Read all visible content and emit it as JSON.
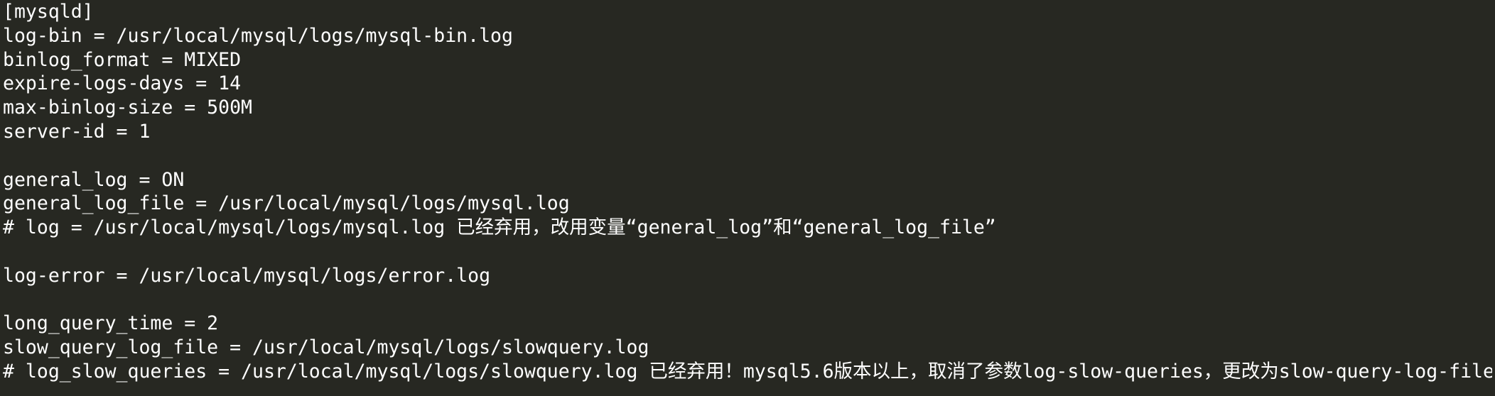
{
  "editor": {
    "lines": [
      "[mysqld]",
      "log-bin = /usr/local/mysql/logs/mysql-bin.log",
      "binlog_format = MIXED",
      "expire-logs-days = 14",
      "max-binlog-size = 500M",
      "server-id = 1",
      "",
      "general_log = ON",
      "general_log_file = /usr/local/mysql/logs/mysql.log",
      "# log = /usr/local/mysql/logs/mysql.log 已经弃用，改用变量“general_log”和“general_log_file”",
      "",
      "log-error = /usr/local/mysql/logs/error.log",
      "",
      "long_query_time = 2",
      "slow_query_log_file = /usr/local/mysql/logs/slowquery.log",
      "# log_slow_queries = /usr/local/mysql/logs/slowquery.log 已经弃用！mysql5.6版本以上，取消了参数log-slow-queries，更改为slow-query-log-file"
    ],
    "colors": {
      "background": "#272822",
      "text": "#ffffff"
    }
  }
}
